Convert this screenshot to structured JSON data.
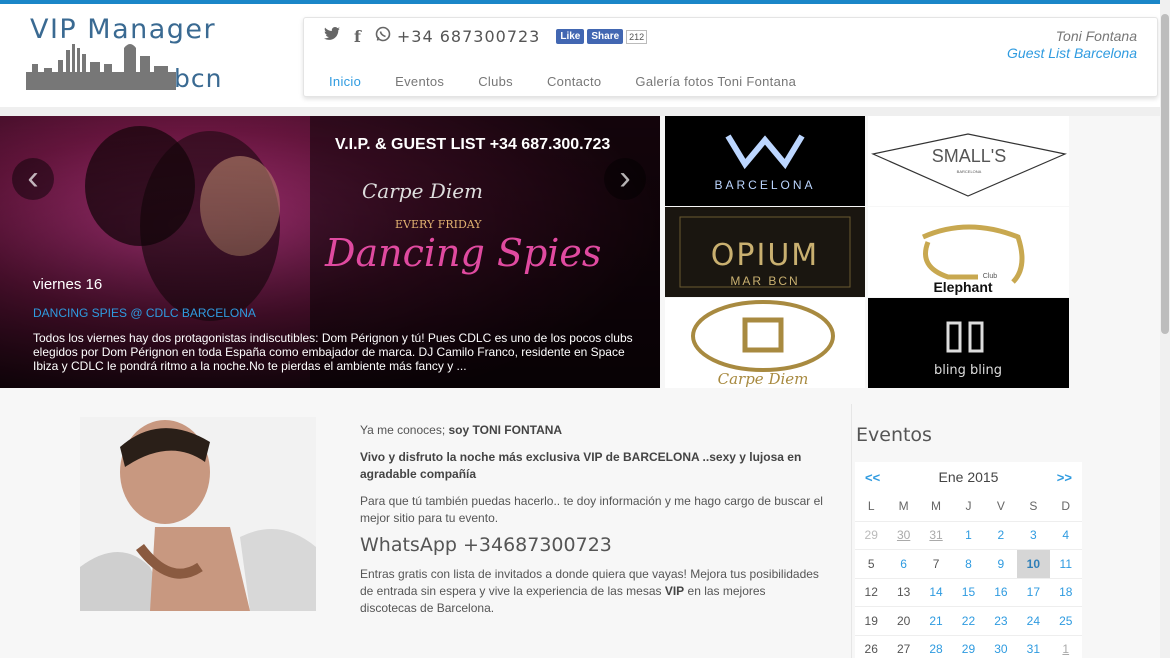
{
  "logo": {
    "top": "VIP  Manager",
    "bottom": "bcn"
  },
  "social": {
    "twitter": "twitter-icon",
    "facebook": "facebook-icon",
    "whatsapp": "whatsapp-icon",
    "phone": "+34 687300723",
    "like": "Like",
    "share": "Share",
    "count": "212"
  },
  "user": {
    "name": "Toni Fontana",
    "subtitle": "Guest List Barcelona"
  },
  "menu": [
    {
      "label": "Inicio",
      "active": true
    },
    {
      "label": "Eventos"
    },
    {
      "label": "Clubs"
    },
    {
      "label": "Contacto"
    },
    {
      "label": "Galería fotos Toni Fontana"
    }
  ],
  "slider": {
    "banner": "V.I.P. & GUEST LIST +34 687.300.723",
    "club_logo": "Carpe Diem",
    "tag": "EVERY FRIDAY",
    "script": "Dancing Spies",
    "date": "viernes 16",
    "title": "DANCING SPIES @ CDLC BARCELONA",
    "desc": "Todos los viernes hay dos protagonistas indiscutibles: Dom Pérignon y tú! Pues CDLC es uno de los pocos clubs elegidos por Dom Pérignon en toda España como embajador de marca. DJ Camilo Franco, residente en Space Ibiza y CDLC le pondrá ritmo a la noche.No te pierdas el ambiente más fancy y ...",
    "prev": "‹",
    "next": "›"
  },
  "clubs": [
    {
      "name": "BARCELONA"
    },
    {
      "name": "SMALL'S",
      "sub": "BARCELONA"
    },
    {
      "name": "OPIUM",
      "sub": "MAR BCN"
    },
    {
      "name": "Elephant",
      "sub": "Club"
    },
    {
      "name": "Carpe Diem"
    },
    {
      "name": "bling bling"
    }
  ],
  "intro": {
    "p1_a": "Ya me conoces; ",
    "p1_b": "soy TONI FONTANA",
    "p2": "Vivo y disfruto la noche más exclusiva VIP de BARCELONA ..sexy y lujosa en agradable compañía",
    "p3": "Para que tú también puedas hacerlo.. te doy información y me hago cargo de buscar el mejor sitio para tu evento.",
    "whatsapp": "WhatsApp +34687300723",
    "p4_a": "Entras gratis con lista de invitados a donde quiera que vayas! Mejora tus posibilidades de entrada sin espera y vive la experiencia de las mesas ",
    "p4_b": "VIP",
    "p4_c": " en las mejores discotecas de Barcelona."
  },
  "events": {
    "title": "Eventos",
    "prev": "<<",
    "next": ">>",
    "month": "Ene 2015",
    "weekdays": [
      "L",
      "M",
      "M",
      "J",
      "V",
      "S",
      "D"
    ],
    "weeks": [
      [
        {
          "d": "29",
          "o": 1
        },
        {
          "d": "30",
          "o": 1,
          "e": 1
        },
        {
          "d": "31",
          "o": 1,
          "e": 1
        },
        {
          "d": "1",
          "e": 1
        },
        {
          "d": "2",
          "e": 1
        },
        {
          "d": "3",
          "e": 1
        },
        {
          "d": "4",
          "e": 1
        }
      ],
      [
        {
          "d": "5"
        },
        {
          "d": "6",
          "e": 1
        },
        {
          "d": "7"
        },
        {
          "d": "8",
          "e": 1
        },
        {
          "d": "9",
          "e": 1
        },
        {
          "d": "10",
          "t": 1
        },
        {
          "d": "11",
          "e": 1
        }
      ],
      [
        {
          "d": "12"
        },
        {
          "d": "13"
        },
        {
          "d": "14",
          "e": 1
        },
        {
          "d": "15",
          "e": 1
        },
        {
          "d": "16",
          "e": 1
        },
        {
          "d": "17",
          "e": 1
        },
        {
          "d": "18",
          "e": 1
        }
      ],
      [
        {
          "d": "19"
        },
        {
          "d": "20"
        },
        {
          "d": "21",
          "e": 1
        },
        {
          "d": "22",
          "e": 1
        },
        {
          "d": "23",
          "e": 1
        },
        {
          "d": "24",
          "e": 1
        },
        {
          "d": "25",
          "e": 1
        }
      ],
      [
        {
          "d": "26"
        },
        {
          "d": "27"
        },
        {
          "d": "28",
          "e": 1
        },
        {
          "d": "29",
          "e": 1
        },
        {
          "d": "30",
          "e": 1
        },
        {
          "d": "31",
          "e": 1
        },
        {
          "d": "1",
          "o": 1,
          "e": 1
        }
      ]
    ]
  }
}
